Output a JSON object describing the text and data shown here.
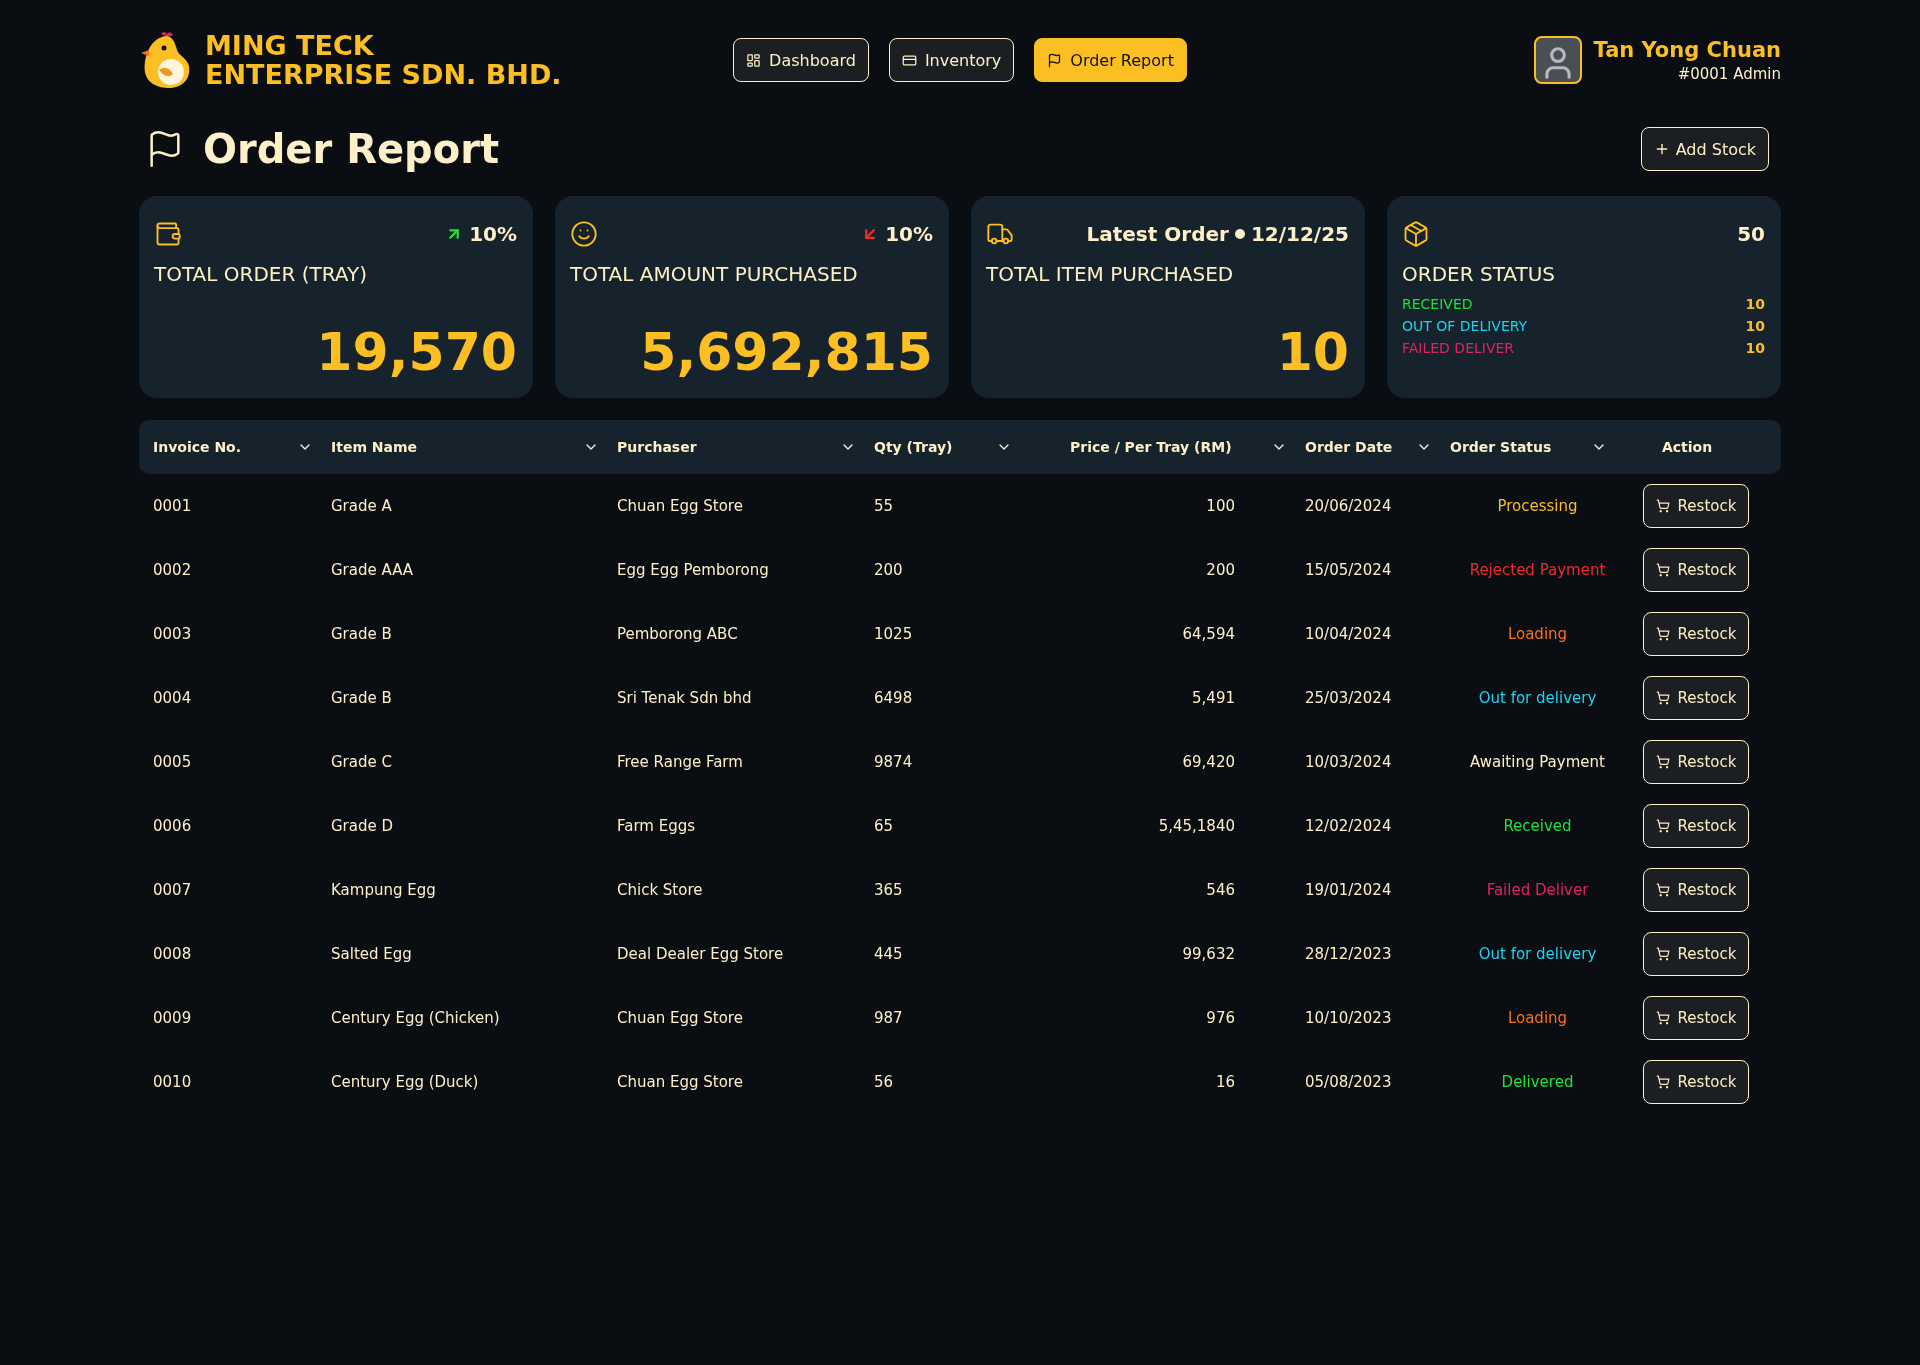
{
  "brand": {
    "line1": "MING TECK",
    "line2": "ENTERPRISE SDN. BHD."
  },
  "nav": [
    {
      "label": "Dashboard",
      "selected": false
    },
    {
      "label": "Inventory",
      "selected": false
    },
    {
      "label": "Order Report",
      "selected": true
    }
  ],
  "user": {
    "name": "Tan Yong Chuan",
    "role": "#0001 Admin"
  },
  "page_title": "Order Report",
  "add_button": "Add Stock",
  "cards": [
    {
      "kind": "rising",
      "change": "10%",
      "title": "TOTAL ORDER (TRAY)",
      "value": "19,570"
    },
    {
      "kind": "falling",
      "change": "10%",
      "title": "TOTAL AMOUNT PURCHASED",
      "value": "5,692,815"
    },
    {
      "kind": "latest",
      "latest_label": "Latest Order",
      "latest_date": "12/12/25",
      "title": "TOTAL ITEM PURCHASED",
      "value": "10"
    },
    {
      "kind": "status",
      "total": "50",
      "title": "ORDER STATUS",
      "statuses": [
        {
          "label": "RECEIVED",
          "count": "10",
          "color": "#22e03a"
        },
        {
          "label": "OUT OF DELIVERY",
          "count": "10",
          "color": "#22d3ee"
        },
        {
          "label": "FAILED DELIVER",
          "count": "10",
          "color": "#e0245e"
        }
      ]
    }
  ],
  "table": {
    "columns": [
      {
        "label": "Invoice No.",
        "sortable": true
      },
      {
        "label": "Item Name",
        "sortable": true
      },
      {
        "label": "Purchaser",
        "sortable": true
      },
      {
        "label": "Qty (Tray)",
        "sortable": true
      },
      {
        "label": "Price / Per Tray (RM)",
        "sortable": true
      },
      {
        "label": "Order Date",
        "sortable": true
      },
      {
        "label": "Order Status",
        "sortable": true
      },
      {
        "label": "Action",
        "sortable": false
      }
    ],
    "rows": [
      {
        "invoice": "0001",
        "item": "Grade A",
        "purchaser": "Chuan Egg Store",
        "qty": "55",
        "price": "100",
        "date": "20/06/2024",
        "status": "Processing",
        "color": "#fbbf24",
        "action": "Restock"
      },
      {
        "invoice": "0002",
        "item": "Grade AAA",
        "purchaser": "Egg Egg Pemborong",
        "qty": "200",
        "price": "200",
        "date": "15/05/2024",
        "status": "Rejected Payment",
        "color": "#ef2b2b",
        "action": "Restock"
      },
      {
        "invoice": "0003",
        "item": "Grade B",
        "purchaser": "Pemborong ABC",
        "qty": "1025",
        "price": "64,594",
        "date": "10/04/2024",
        "status": "Loading",
        "color": "#f97316",
        "action": "Restock"
      },
      {
        "invoice": "0004",
        "item": "Grade B",
        "purchaser": "Sri Tenak Sdn bhd",
        "qty": "6498",
        "price": "5,491",
        "date": "25/03/2024",
        "status": "Out for delivery",
        "color": "#22d3ee",
        "action": "Restock"
      },
      {
        "invoice": "0005",
        "item": "Grade C",
        "purchaser": "Free Range Farm",
        "qty": "9874",
        "price": "69,420",
        "date": "10/03/2024",
        "status": "Awaiting Payment",
        "color": "#fdf0c8",
        "action": "Restock"
      },
      {
        "invoice": "0006",
        "item": "Grade D",
        "purchaser": "Farm Eggs",
        "qty": "65",
        "price": "5,45,1840",
        "date": "12/02/2024",
        "status": "Received",
        "color": "#22e03a",
        "action": "Restock"
      },
      {
        "invoice": "0007",
        "item": "Kampung Egg",
        "purchaser": "Chick Store",
        "qty": "365",
        "price": "546",
        "date": "19/01/2024",
        "status": "Failed Deliver",
        "color": "#e0245e",
        "action": "Restock"
      },
      {
        "invoice": "0008",
        "item": "Salted Egg",
        "purchaser": "Deal Dealer Egg Store",
        "qty": "445",
        "price": "99,632",
        "date": "28/12/2023",
        "status": "Out for delivery",
        "color": "#22d3ee",
        "action": "Restock"
      },
      {
        "invoice": "0009",
        "item": "Century Egg (Chicken)",
        "purchaser": "Chuan Egg Store",
        "qty": "987",
        "price": "976",
        "date": "10/10/2023",
        "status": "Loading",
        "color": "#f97316",
        "action": "Restock"
      },
      {
        "invoice": "0010",
        "item": "Century Egg (Duck)",
        "purchaser": "Chuan Egg Store",
        "qty": "56",
        "price": "16",
        "date": "05/08/2023",
        "status": "Delivered",
        "color": "#22e03a",
        "action": "Restock"
      }
    ]
  }
}
